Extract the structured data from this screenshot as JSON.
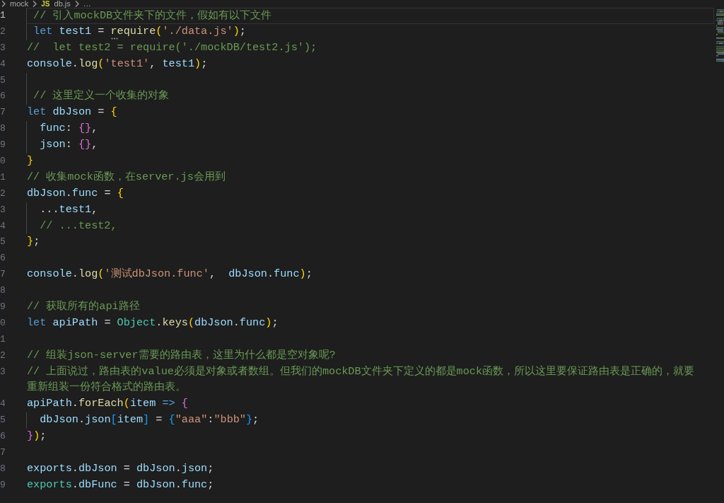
{
  "breadcrumbs": [
    {
      "label": "mock"
    },
    {
      "label": "db.js",
      "file_badge": "JS"
    },
    {
      "label": "…"
    }
  ],
  "editor": {
    "lines": [
      {
        "number": "1",
        "current": true,
        "tokens": [
          {
            "kind": "comment",
            "text": " // 引入mockDB文件夹下的文件，假如有以下文件"
          }
        ]
      },
      {
        "number": "2",
        "current": false,
        "tokens": [
          {
            "kind": "keyword",
            "text": " let"
          },
          {
            "kind": "variable",
            "text": " test1"
          },
          {
            "kind": "punct",
            "text": " = "
          },
          {
            "kind": "function",
            "text": "require",
            "hint": true
          },
          {
            "kind": "bracket1",
            "text": "("
          },
          {
            "kind": "string",
            "text": "'./data.js'"
          },
          {
            "kind": "bracket1",
            "text": ")"
          },
          {
            "kind": "punct",
            "text": ";"
          }
        ]
      },
      {
        "number": "3",
        "current": false,
        "tokens": [
          {
            "kind": "comment",
            "text": "//  let test2 = require('./mockDB/test2.js');"
          }
        ]
      },
      {
        "number": "4",
        "current": false,
        "tokens": [
          {
            "kind": "variable",
            "text": "console"
          },
          {
            "kind": "punct",
            "text": "."
          },
          {
            "kind": "function",
            "text": "log"
          },
          {
            "kind": "bracket1",
            "text": "("
          },
          {
            "kind": "string",
            "text": "'test1'"
          },
          {
            "kind": "punct",
            "text": ", "
          },
          {
            "kind": "variable",
            "text": "test1"
          },
          {
            "kind": "bracket1",
            "text": ")"
          },
          {
            "kind": "punct",
            "text": ";"
          }
        ]
      },
      {
        "number": "5",
        "current": false
      },
      {
        "number": "6",
        "current": false,
        "tokens": [
          {
            "kind": "comment",
            "text": " // 这里定义一个收集的对象"
          }
        ]
      },
      {
        "number": "7",
        "current": false,
        "tokens": [
          {
            "kind": "keyword",
            "text": "let"
          },
          {
            "kind": "variable",
            "text": " dbJson"
          },
          {
            "kind": "punct",
            "text": " = "
          },
          {
            "kind": "bracket1",
            "text": "{"
          }
        ]
      },
      {
        "number": "8",
        "current": false,
        "tokens": [
          {
            "kind": "variable",
            "text": "  func"
          },
          {
            "kind": "punct",
            "text": ": "
          },
          {
            "kind": "bracket2",
            "text": "{}"
          },
          {
            "kind": "punct",
            "text": ","
          }
        ]
      },
      {
        "number": "9",
        "current": false,
        "tokens": [
          {
            "kind": "variable",
            "text": "  json"
          },
          {
            "kind": "punct",
            "text": ": "
          },
          {
            "kind": "bracket2",
            "text": "{}"
          },
          {
            "kind": "punct",
            "text": ","
          }
        ]
      },
      {
        "number": "0",
        "current": false,
        "tokens": [
          {
            "kind": "bracket1",
            "text": "}"
          }
        ]
      },
      {
        "number": "1",
        "current": false,
        "tokens": [
          {
            "kind": "comment",
            "text": "// 收集mock函数，在server.js会用到"
          }
        ]
      },
      {
        "number": "2",
        "current": false,
        "tokens": [
          {
            "kind": "variable",
            "text": "dbJson"
          },
          {
            "kind": "punct",
            "text": "."
          },
          {
            "kind": "variable",
            "text": "func"
          },
          {
            "kind": "punct",
            "text": " = "
          },
          {
            "kind": "bracket1",
            "text": "{"
          }
        ]
      },
      {
        "number": "3",
        "current": false,
        "tokens": [
          {
            "kind": "punct",
            "text": "  ..."
          },
          {
            "kind": "variable",
            "text": "test1"
          },
          {
            "kind": "punct",
            "text": ","
          }
        ]
      },
      {
        "number": "4",
        "current": false,
        "tokens": [
          {
            "kind": "comment",
            "text": "  // ...test2,"
          }
        ]
      },
      {
        "number": "5",
        "current": false,
        "tokens": [
          {
            "kind": "bracket1",
            "text": "}"
          },
          {
            "kind": "punct",
            "text": ";"
          }
        ]
      },
      {
        "number": "6",
        "current": false
      },
      {
        "number": "7",
        "current": false,
        "tokens": [
          {
            "kind": "variable",
            "text": "console"
          },
          {
            "kind": "punct",
            "text": "."
          },
          {
            "kind": "function",
            "text": "log"
          },
          {
            "kind": "bracket1",
            "text": "("
          },
          {
            "kind": "string",
            "text": "'测试dbJson.func'"
          },
          {
            "kind": "punct",
            "text": ",  "
          },
          {
            "kind": "variable",
            "text": "dbJson"
          },
          {
            "kind": "punct",
            "text": "."
          },
          {
            "kind": "variable",
            "text": "func"
          },
          {
            "kind": "bracket1",
            "text": ")"
          },
          {
            "kind": "punct",
            "text": ";"
          }
        ]
      },
      {
        "number": "8",
        "current": false
      },
      {
        "number": "9",
        "current": false,
        "tokens": [
          {
            "kind": "comment",
            "text": "// 获取所有的api路径"
          }
        ]
      },
      {
        "number": "0",
        "current": false,
        "tokens": [
          {
            "kind": "keyword",
            "text": "let"
          },
          {
            "kind": "variable",
            "text": " apiPath"
          },
          {
            "kind": "punct",
            "text": " = "
          },
          {
            "kind": "class",
            "text": "Object"
          },
          {
            "kind": "punct",
            "text": "."
          },
          {
            "kind": "function",
            "text": "keys"
          },
          {
            "kind": "bracket1",
            "text": "("
          },
          {
            "kind": "variable",
            "text": "dbJson"
          },
          {
            "kind": "punct",
            "text": "."
          },
          {
            "kind": "variable",
            "text": "func"
          },
          {
            "kind": "bracket1",
            "text": ")"
          },
          {
            "kind": "punct",
            "text": ";"
          }
        ]
      },
      {
        "number": "1",
        "current": false
      },
      {
        "number": "2",
        "current": false,
        "tokens": [
          {
            "kind": "comment",
            "text": "// 组装json-server需要的路由表，这里为什么都是空对象呢?"
          }
        ]
      },
      {
        "number": "3",
        "current": false,
        "tokens": [
          {
            "kind": "comment",
            "text": "// 上面说过，路由表的value必须是对象或者数组。但我们的mockDB文件夹下定义的都是mock函数，所以这里要保证路由表是正确的，就要"
          }
        ],
        "wrapped": [
          {
            "kind": "comment",
            "text": "重新组装一份符合格式的路由表。"
          }
        ]
      },
      {
        "number": "4",
        "current": false,
        "tokens": [
          {
            "kind": "variable",
            "text": "apiPath"
          },
          {
            "kind": "punct",
            "text": "."
          },
          {
            "kind": "function",
            "text": "forEach"
          },
          {
            "kind": "bracket1",
            "text": "("
          },
          {
            "kind": "variable",
            "text": "item"
          },
          {
            "kind": "keyword",
            "text": " => "
          },
          {
            "kind": "bracket2",
            "text": "{"
          }
        ]
      },
      {
        "number": "5",
        "current": false,
        "tokens": [
          {
            "kind": "variable",
            "text": "  dbJson"
          },
          {
            "kind": "punct",
            "text": "."
          },
          {
            "kind": "variable",
            "text": "json"
          },
          {
            "kind": "bracket3",
            "text": "["
          },
          {
            "kind": "variable",
            "text": "item"
          },
          {
            "kind": "bracket3",
            "text": "]"
          },
          {
            "kind": "punct",
            "text": " = "
          },
          {
            "kind": "bracket3",
            "text": "{"
          },
          {
            "kind": "string",
            "text": "\"aaa\""
          },
          {
            "kind": "punct",
            "text": ":"
          },
          {
            "kind": "string",
            "text": "\"bbb\""
          },
          {
            "kind": "bracket3",
            "text": "}"
          },
          {
            "kind": "punct",
            "text": ";"
          }
        ]
      },
      {
        "number": "6",
        "current": false,
        "tokens": [
          {
            "kind": "bracket2",
            "text": "}"
          },
          {
            "kind": "bracket1",
            "text": ")"
          },
          {
            "kind": "punct",
            "text": ";"
          }
        ]
      },
      {
        "number": "7",
        "current": false
      },
      {
        "number": "8",
        "current": false,
        "tokens": [
          {
            "kind": "variable",
            "text": "exports"
          },
          {
            "kind": "punct",
            "text": "."
          },
          {
            "kind": "variable",
            "text": "dbJson"
          },
          {
            "kind": "punct",
            "text": " = "
          },
          {
            "kind": "variable",
            "text": "dbJson"
          },
          {
            "kind": "punct",
            "text": "."
          },
          {
            "kind": "variable",
            "text": "json"
          },
          {
            "kind": "punct",
            "text": ";"
          }
        ]
      },
      {
        "number": "9",
        "current": false,
        "tokens": [
          {
            "kind": "class",
            "text": "exports"
          },
          {
            "kind": "punct",
            "text": "."
          },
          {
            "kind": "variable",
            "text": "dbFunc"
          },
          {
            "kind": "punct",
            "text": " = "
          },
          {
            "kind": "variable",
            "text": "dbJson"
          },
          {
            "kind": "punct",
            "text": "."
          },
          {
            "kind": "variable",
            "text": "func"
          },
          {
            "kind": "punct",
            "text": ";"
          }
        ]
      }
    ]
  }
}
